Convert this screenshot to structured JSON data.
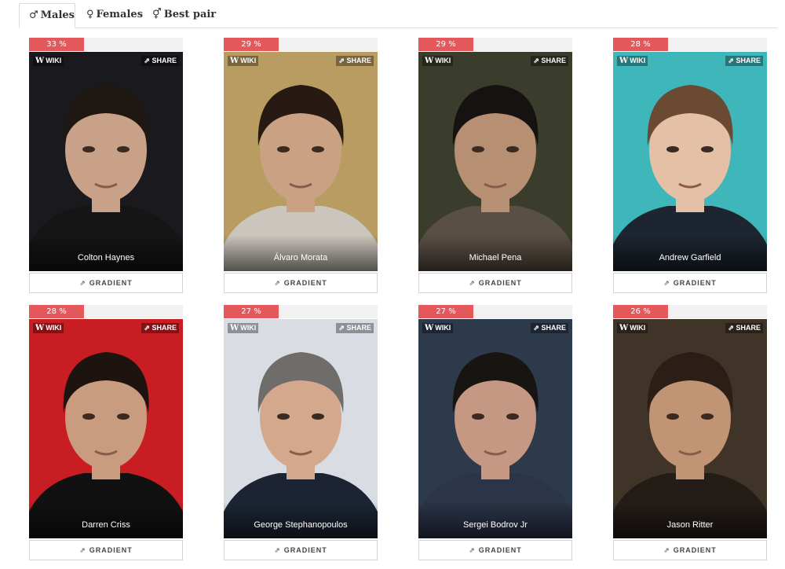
{
  "tabs": [
    {
      "symbol": "♂",
      "label": "Males",
      "active": true
    },
    {
      "symbol": "♀",
      "label": "Females",
      "active": false
    },
    {
      "symbol": "⚥",
      "label": "Best pair",
      "active": false
    }
  ],
  "labels": {
    "wiki": "WIKI",
    "wiki_mark": "W",
    "share": "SHARE",
    "gradient": "GRADIENT"
  },
  "cards": [
    {
      "name": "Colton Haynes",
      "percent": "33 %",
      "bg": "#1a1a1e",
      "skin": "#c9a088",
      "hair": "#1f1712",
      "shirt": "#151515"
    },
    {
      "name": "Álvaro Morata",
      "percent": "29 %",
      "bg": "#b89c62",
      "skin": "#caa183",
      "hair": "#261a12",
      "shirt": "#cbc6bd"
    },
    {
      "name": "Michael Pena",
      "percent": "29 %",
      "bg": "#3a3d2c",
      "skin": "#b78f73",
      "hair": "#151211",
      "shirt": "#5a4f44"
    },
    {
      "name": "Andrew Garfield",
      "percent": "28 %",
      "bg": "#3fb6b9",
      "skin": "#e3c0a6",
      "hair": "#6b4a34",
      "shirt": "#1d2530"
    },
    {
      "name": "Darren Criss",
      "percent": "28 %",
      "bg": "#c81d22",
      "skin": "#c99c80",
      "hair": "#1d1410",
      "shirt": "#111111"
    },
    {
      "name": "George Stephanopoulos",
      "percent": "27 %",
      "bg": "#d9dde3",
      "skin": "#d3a88c",
      "hair": "#6f6c69",
      "shirt": "#1c2434"
    },
    {
      "name": "Sergei Bodrov Jr",
      "percent": "27 %",
      "bg": "#2c3a4c",
      "skin": "#c49882",
      "hair": "#181411",
      "shirt": "#2b3448"
    },
    {
      "name": "Jason Ritter",
      "percent": "26 %",
      "bg": "#403328",
      "skin": "#c19474",
      "hair": "#2a1e16",
      "shirt": "#241c17"
    }
  ]
}
